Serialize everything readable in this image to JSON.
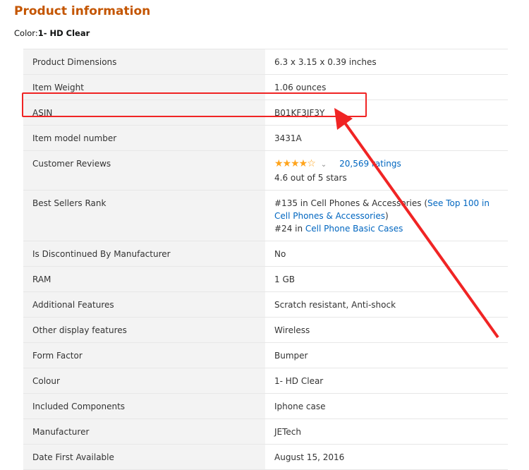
{
  "title": "Product information",
  "color_label": "Color:",
  "color_value": "1- HD Clear",
  "rows": [
    {
      "k": "Product Dimensions",
      "v": "6.3 x 3.15 x 0.39 inches"
    },
    {
      "k": "Item Weight",
      "v": "1.06 ounces"
    },
    {
      "k": "ASIN",
      "v": "B01KF3JF3Y"
    },
    {
      "k": "Item model number",
      "v": "3431A"
    },
    {
      "k": "Customer Reviews"
    },
    {
      "k": "Best Sellers Rank"
    },
    {
      "k": "Is Discontinued By Manufacturer",
      "v": "No"
    },
    {
      "k": "RAM",
      "v": "1 GB"
    },
    {
      "k": "Additional Features",
      "v": "Scratch resistant, Anti-shock"
    },
    {
      "k": "Other display features",
      "v": "Wireless"
    },
    {
      "k": "Form Factor",
      "v": "Bumper"
    },
    {
      "k": "Colour",
      "v": "1- HD Clear"
    },
    {
      "k": "Included Components",
      "v": "Iphone case"
    },
    {
      "k": "Manufacturer",
      "v": "JETech"
    },
    {
      "k": "Date First Available",
      "v": "August 15, 2016"
    }
  ],
  "reviews": {
    "stars": "★★★★☆",
    "rating": 4.6,
    "ratings_link": "20,569 ratings",
    "rating_text": "4.6 out of 5 stars"
  },
  "rank": {
    "r1": "#135 in Cell Phones & Accessories (",
    "r1_link": "See Top 100 in Cell Phones & Accessories",
    "r1_end": ")",
    "r2": "#24 in ",
    "r2_link": "Cell Phone Basic Cases"
  },
  "annotation_color": "#f02424"
}
